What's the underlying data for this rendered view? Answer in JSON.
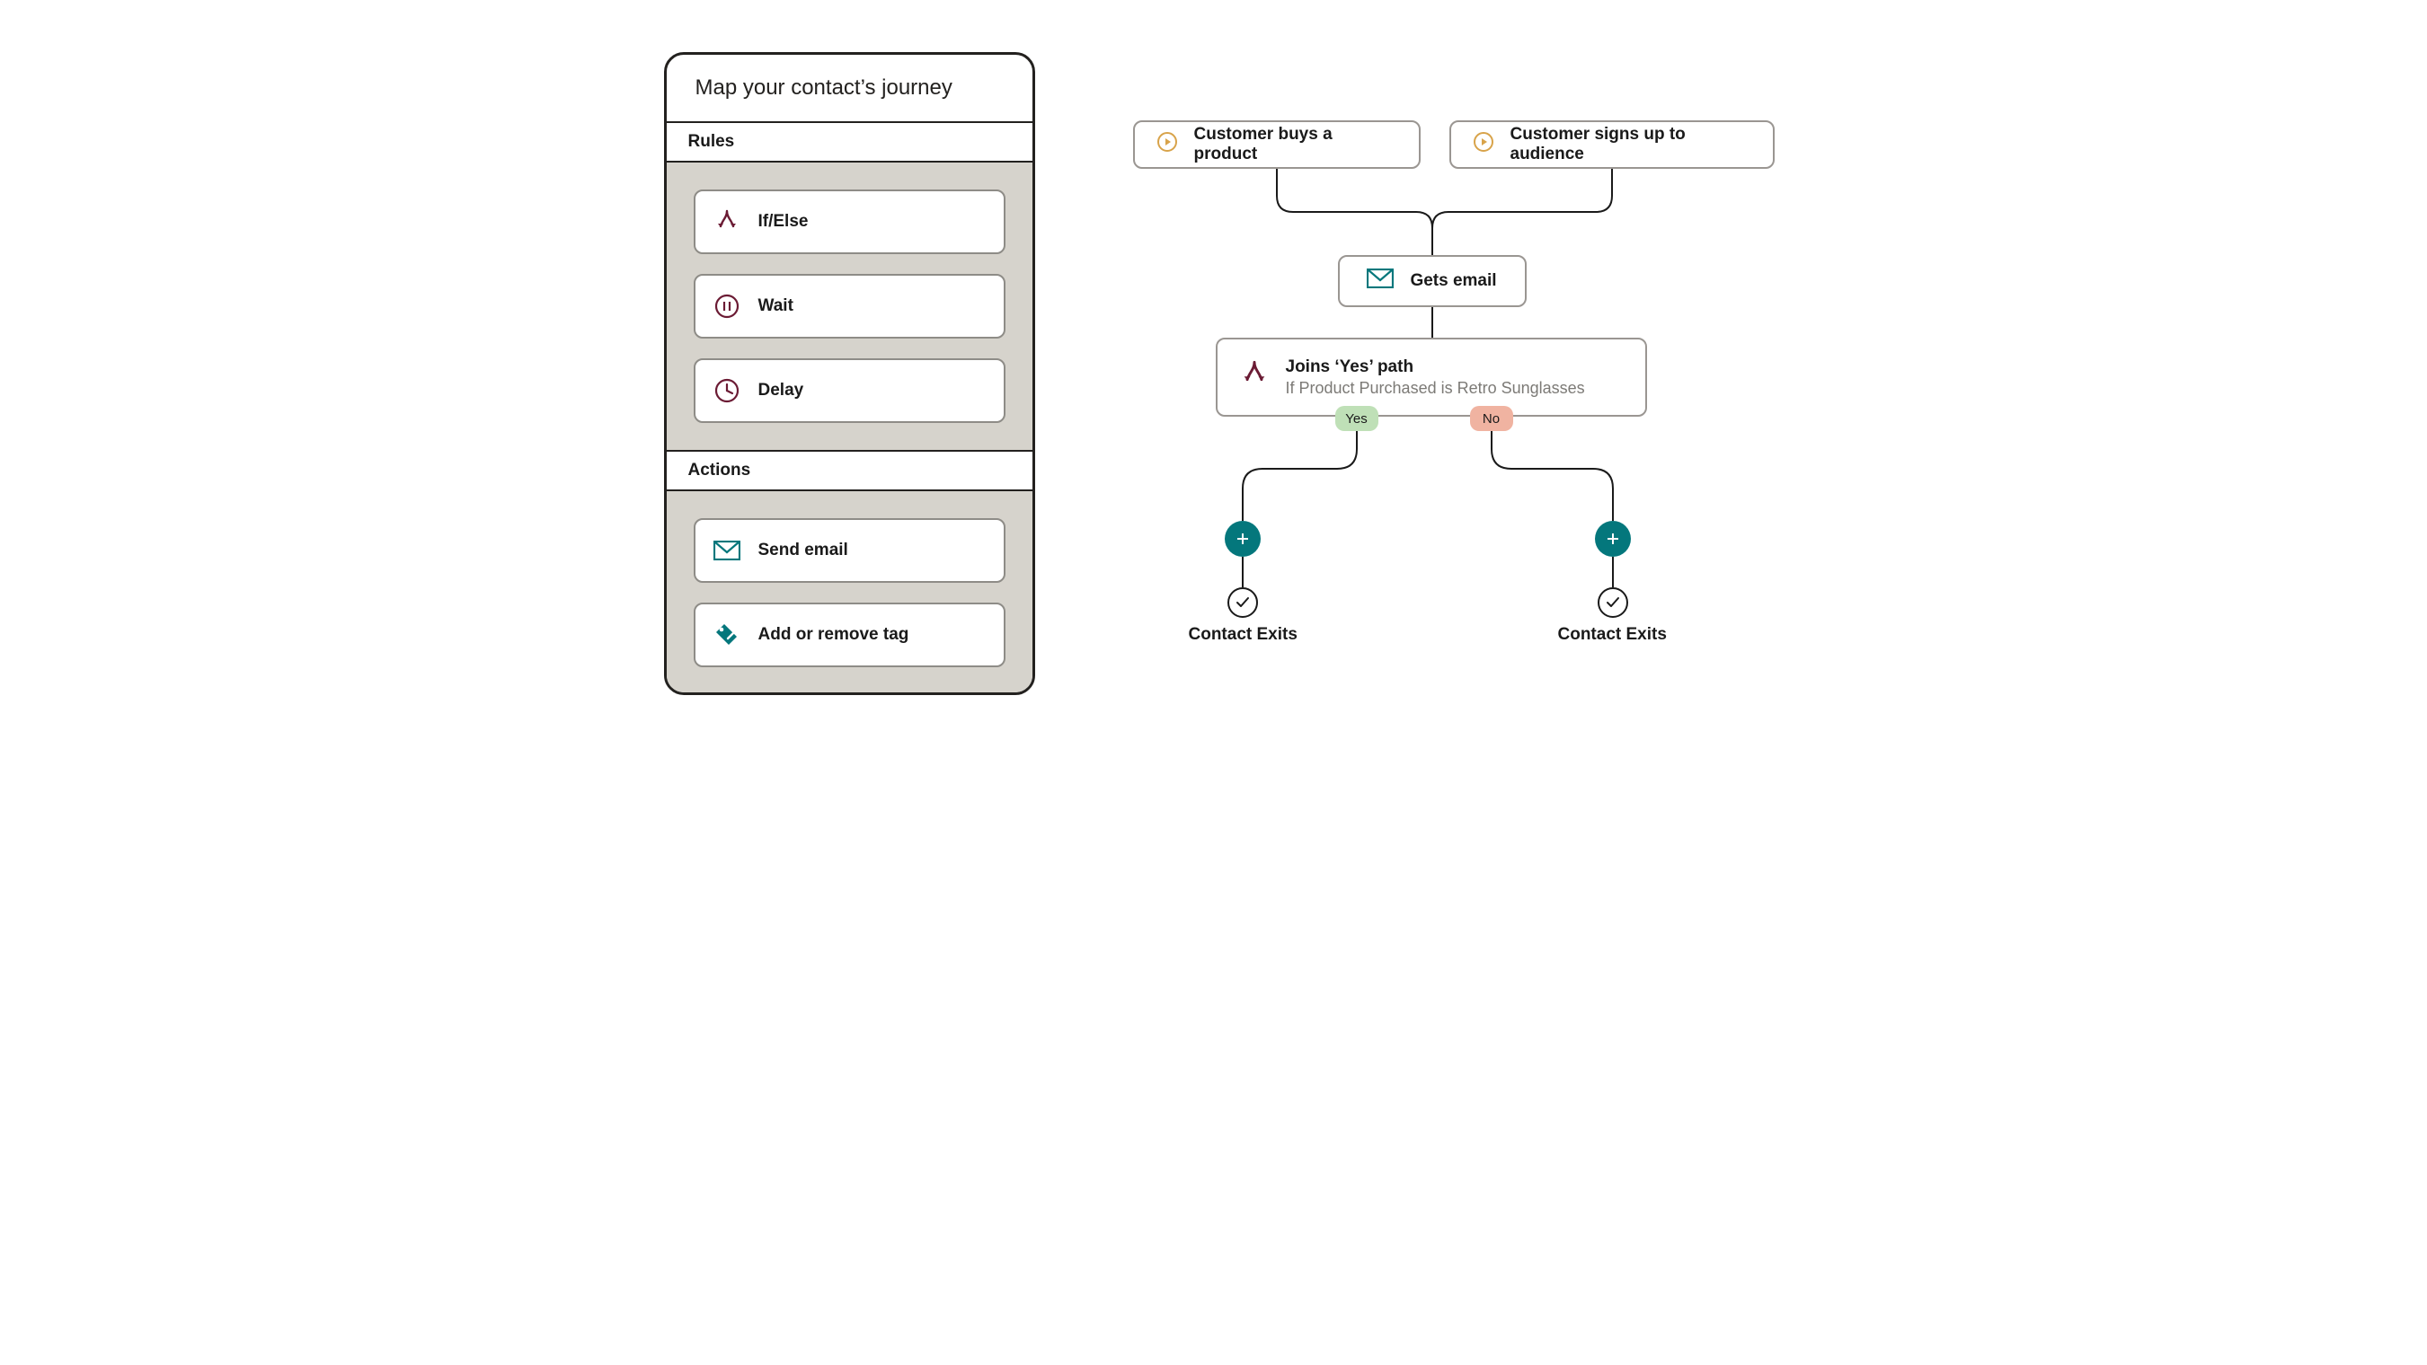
{
  "panel": {
    "title": "Map your contact’s journey",
    "rules": {
      "header": "Rules",
      "items": [
        {
          "label": "If/Else"
        },
        {
          "label": "Wait"
        },
        {
          "label": "Delay"
        }
      ]
    },
    "actions": {
      "header": "Actions",
      "items": [
        {
          "label": "Send email"
        },
        {
          "label": "Add or remove tag"
        }
      ]
    }
  },
  "canvas": {
    "triggers": [
      {
        "label": "Customer buys a product"
      },
      {
        "label": "Customer signs up to audience"
      }
    ],
    "email_node": {
      "label": "Gets email"
    },
    "condition": {
      "title": "Joins ‘Yes’ path",
      "subtitle": "If Product Purchased is Retro Sunglasses"
    },
    "pills": {
      "yes": "Yes",
      "no": "No"
    },
    "exit_label": "Contact Exits"
  },
  "colors": {
    "teal": "#04777c",
    "maroon": "#6b1b34",
    "gold": "#d8a34a",
    "pill_yes": "#bfe0b7",
    "pill_no": "#f0b3a1"
  }
}
